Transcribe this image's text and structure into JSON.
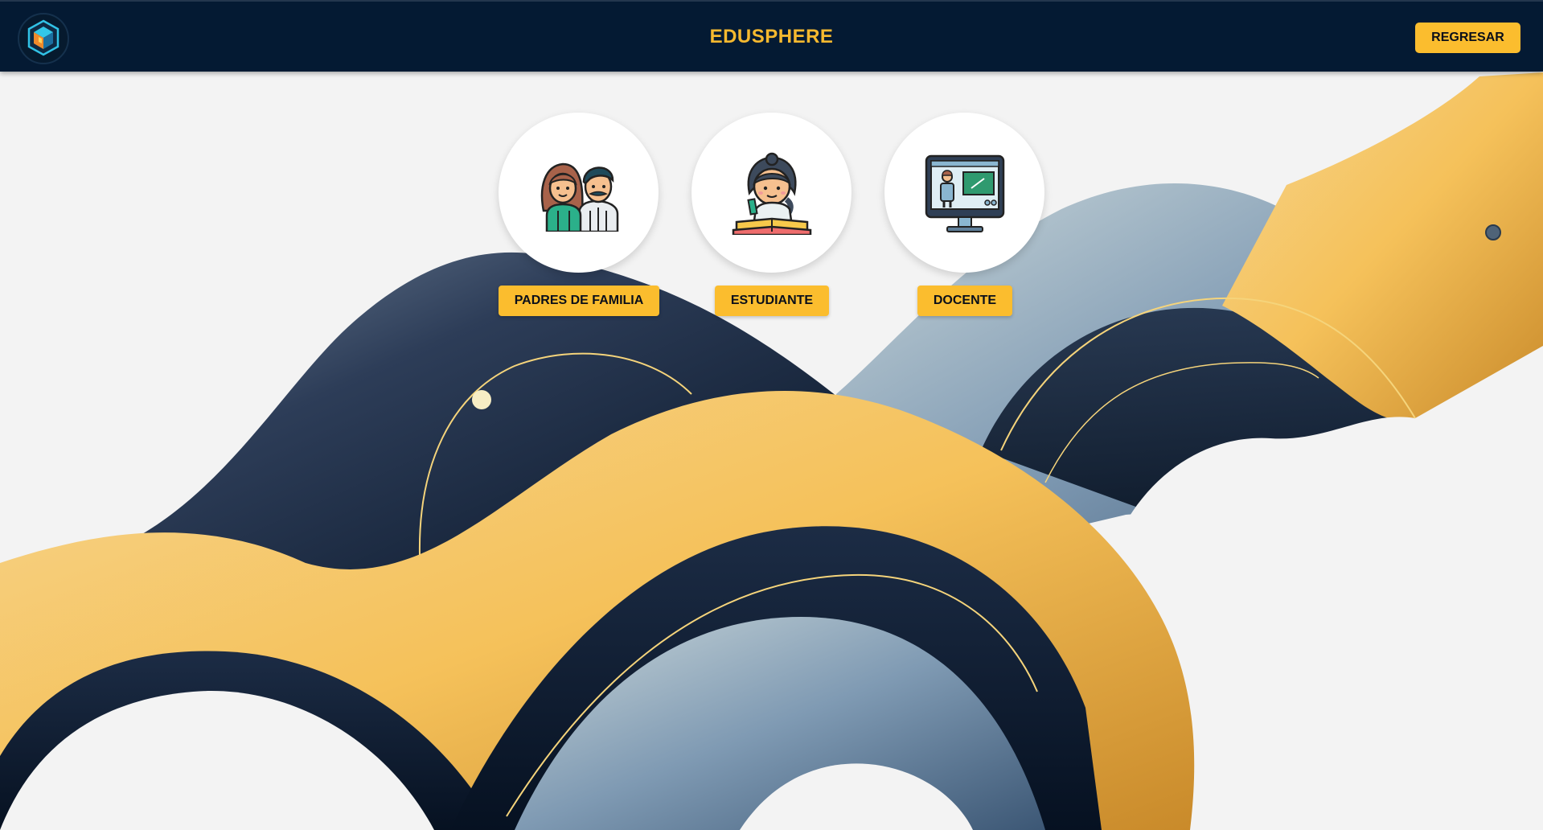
{
  "header": {
    "app_title": "EDUSPHERE",
    "back_label": "REGRESAR",
    "logo_icon": "cube-logo-icon"
  },
  "roles": [
    {
      "label": "PADRES DE FAMILIA",
      "icon": "parents-icon"
    },
    {
      "label": "ESTUDIANTE",
      "icon": "student-icon"
    },
    {
      "label": "DOCENTE",
      "icon": "teacher-icon"
    }
  ],
  "colors": {
    "header_bg": "#041a33",
    "accent": "#fbbd2e",
    "title": "#f6b92f",
    "wave_navy": "#1c2d48",
    "wave_gold": "#f1b94c",
    "wave_steel": "#6e8aa6"
  }
}
